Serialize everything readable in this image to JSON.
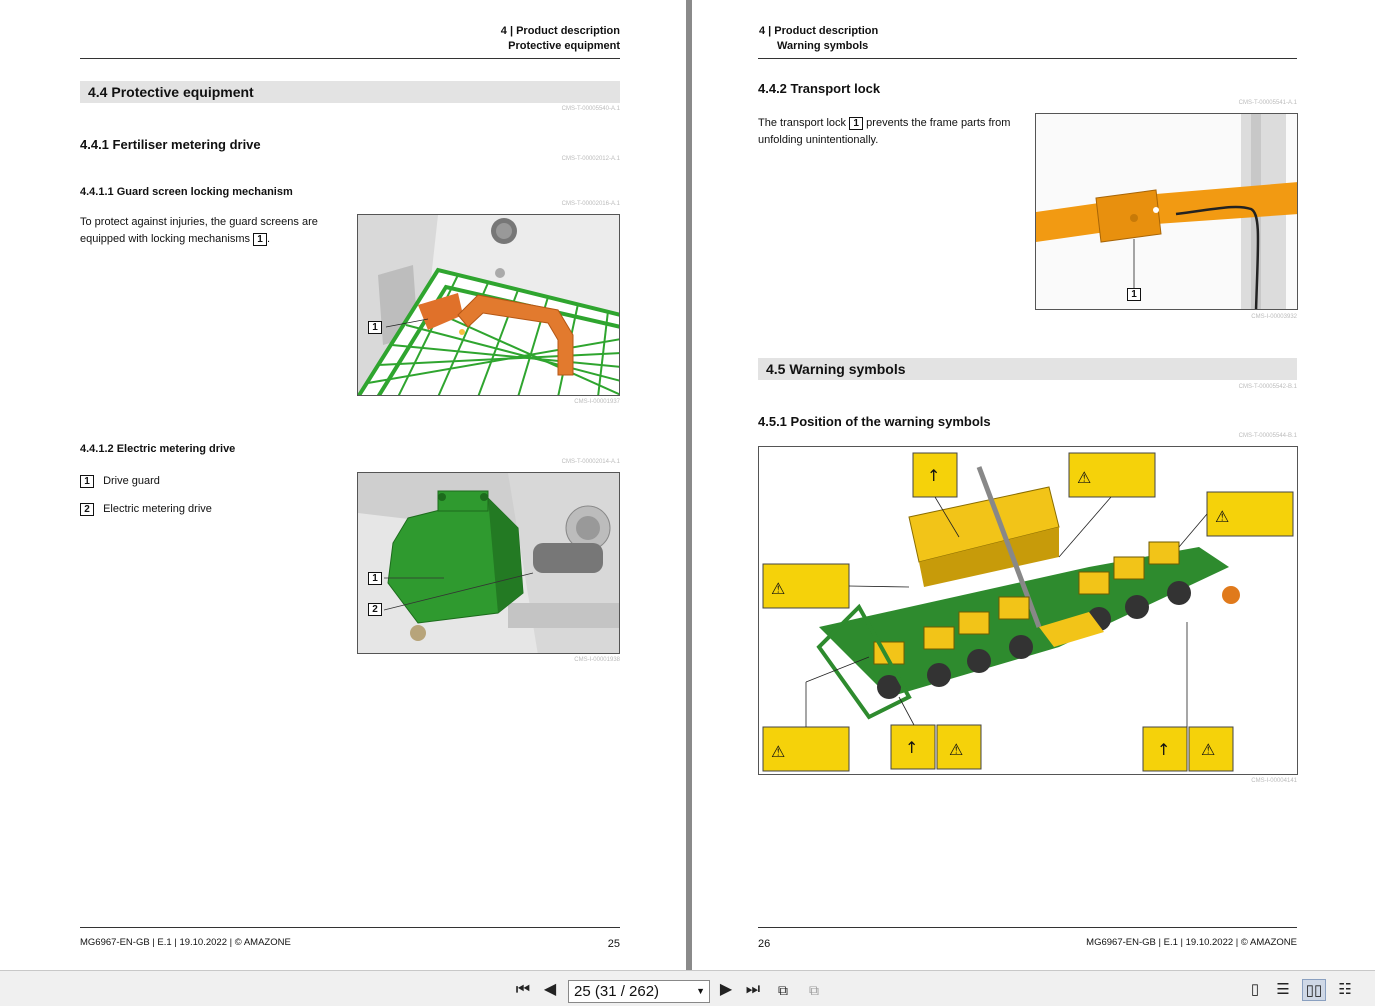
{
  "left_page": {
    "header": {
      "chapter": "4 | Product description",
      "section": "Protective equipment"
    },
    "section_title": "4.4  Protective equipment",
    "codes": [
      "CMS-T-00005540-A.1",
      "CMS-T-00002012-A.1",
      "CMS-T-00002016-A.1",
      "CMS-I-00001937",
      "CMS-T-00002014-A.1",
      "CMS-I-00001938"
    ],
    "sub1_title": "4.4.1  Fertiliser metering drive",
    "sub1a_title": "4.4.1.1 Guard screen locking mechanism",
    "sub1a_text_1": "To protect against injuries, the guard screens are",
    "sub1a_text_2": "equipped with locking mechanisms",
    "callout_1": "1",
    "sub1b_title": "4.4.1.2 Electric metering drive",
    "legend": [
      {
        "num": "1",
        "label": "Drive guard"
      },
      {
        "num": "2",
        "label": "Electric metering drive"
      }
    ],
    "fig2_callouts": [
      "1",
      "2"
    ],
    "footer": "MG6967-EN-GB | E.1 | 19.10.2022 | © AMAZONE",
    "page_number": "25"
  },
  "right_page": {
    "header": {
      "chapter": "4 | Product description",
      "section": "Warning symbols"
    },
    "sub2_title": "4.4.2  Transport lock",
    "codes": [
      "CMS-T-00005541-A.1",
      "CMS-I-00003932",
      "CMS-T-00005542-B.1",
      "CMS-T-00005544-B.1",
      "CMS-I-00004141"
    ],
    "sub2_text_1a": "The transport lock",
    "sub2_text_1b": "prevents the frame parts from",
    "sub2_text_2": "unfolding unintentionally.",
    "callout_1": "1",
    "section_title": "4.5  Warning symbols",
    "sub3_title": "4.5.1  Position of the warning symbols",
    "footer": "MG6967-EN-GB | E.1 | 19.10.2022 | © AMAZONE",
    "page_number": "26"
  },
  "toolbar": {
    "page_indicator": "25 (31 / 262)",
    "icons": [
      "first-page-icon",
      "previous-page-icon",
      "next-page-icon",
      "last-page-icon",
      "go-back-view-icon",
      "go-forward-view-icon",
      "single-page-icon",
      "continuous-page-icon",
      "facing-pages-icon",
      "continuous-facing-icon"
    ]
  },
  "colors": {
    "warning_yellow": "#f5d20a",
    "machine_green": "#2f9a2f",
    "lock_orange": "#e07a1c",
    "section_bar": "#e3e3e3"
  }
}
